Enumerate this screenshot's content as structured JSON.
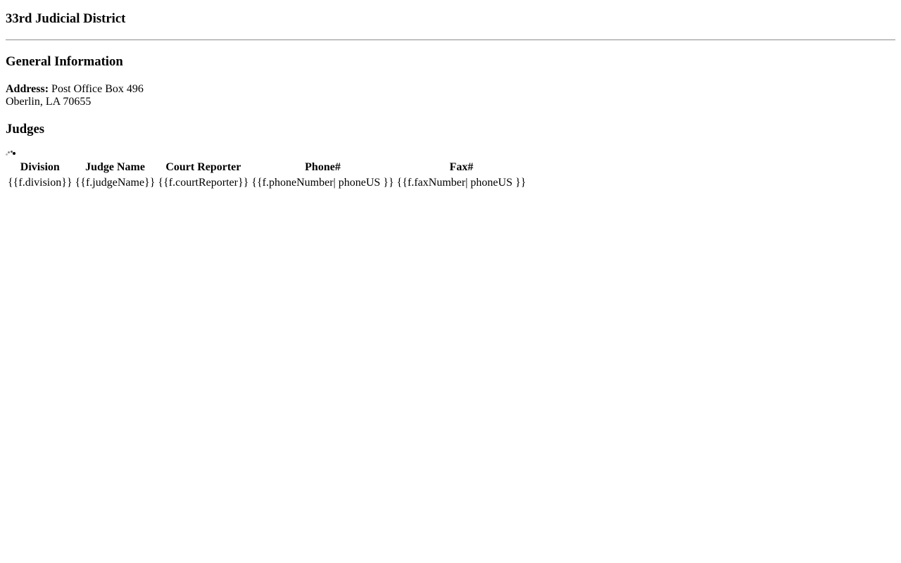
{
  "district": {
    "title": "33rd Judicial District"
  },
  "general": {
    "heading": "General Information",
    "address_label": "Address:",
    "address_line1": "Post Office Box 496",
    "address_line2": "Oberlin, LA 70655"
  },
  "judges": {
    "heading": "Judges",
    "loading_icon": "loading-spinner-icon",
    "columns": [
      "Division",
      "Judge Name",
      "Court Reporter",
      "Phone#",
      "Fax#"
    ],
    "rows": [
      [
        "{{f.division}}",
        "{{f.judgeName}}",
        "{{f.courtReporter}}",
        "{{f.phoneNumber| phoneUS }}",
        "{{f.faxNumber| phoneUS }}"
      ]
    ]
  }
}
